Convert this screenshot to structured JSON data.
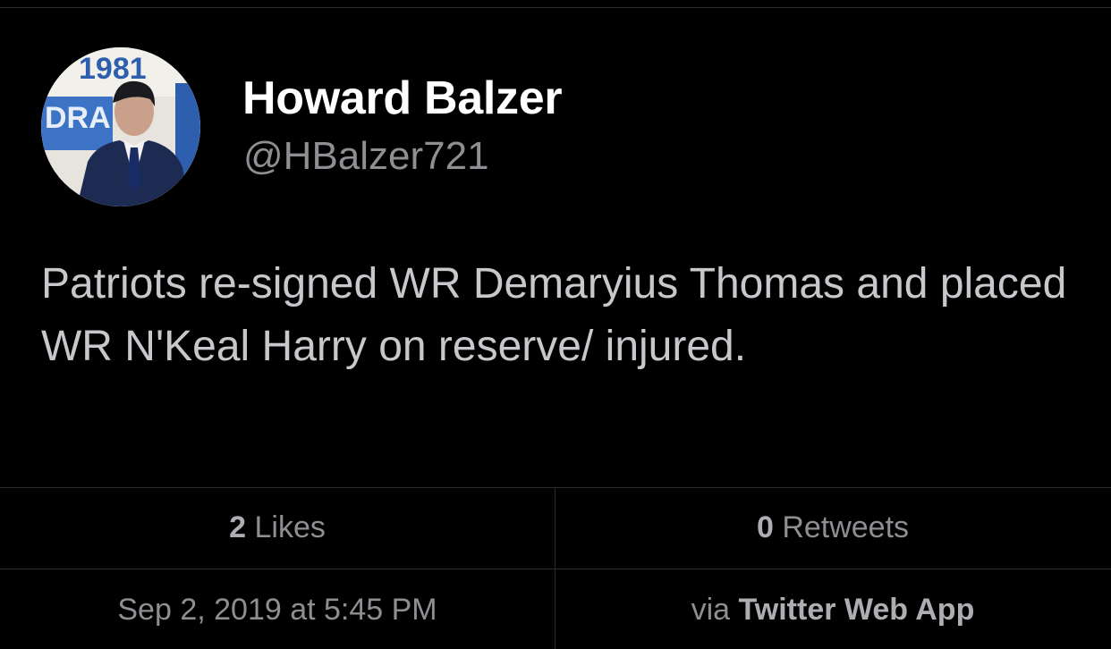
{
  "tweet": {
    "author": {
      "display_name": "Howard Balzer",
      "handle": "@HBalzer721",
      "avatar_text": "1981 DRA"
    },
    "text": "Patriots re-signed WR Demaryius Thomas and placed WR N'Keal Harry on reserve/ injured.",
    "stats": {
      "likes_count": "2",
      "likes_label": "Likes",
      "retweets_count": "0",
      "retweets_label": "Retweets"
    },
    "timestamp": "Sep 2, 2019 at 5:45 PM",
    "source_prefix": "via",
    "source_name": "Twitter Web App"
  },
  "colors": {
    "background": "#000000",
    "name": "#ffffff",
    "secondary_text": "#8e8e93",
    "body_text": "#c7c7cc",
    "divider": "#2c2c2e"
  }
}
